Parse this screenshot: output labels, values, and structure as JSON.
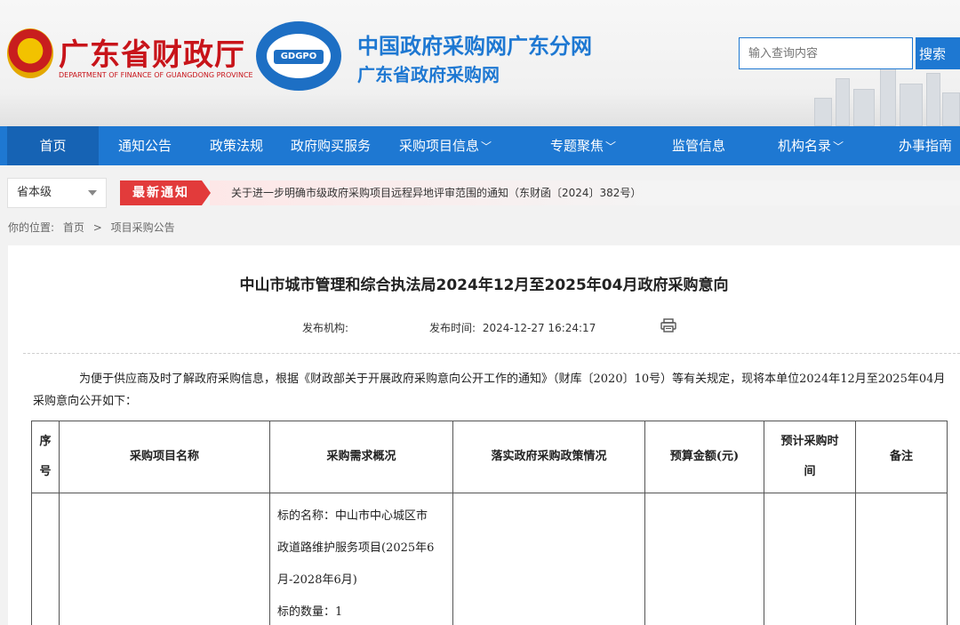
{
  "header": {
    "dept_name_cn": "广东省财政厅",
    "dept_name_en": "DEPARTMENT OF FINANCE OF GUANGDONG PROVINCE",
    "logo_text": "GDGPO",
    "site_title": "中国政府采购网广东分网",
    "site_subtitle": "广东省政府采购网",
    "search": {
      "placeholder": "输入查询内容",
      "button_label": "搜索"
    }
  },
  "nav": {
    "items": [
      {
        "label": "首页"
      },
      {
        "label": "通知公告"
      },
      {
        "label": "政策法规"
      },
      {
        "label": "政府购买服务"
      },
      {
        "label": "采购项目信息"
      },
      {
        "label": "专题聚焦"
      },
      {
        "label": "监管信息"
      },
      {
        "label": "机构名录"
      },
      {
        "label": "办事指南"
      }
    ],
    "active_index": 0
  },
  "notice_bar": {
    "level_select": "省本级",
    "badge": "最新通知",
    "text": "关于进一步明确市级政府采购项目远程异地评审范围的通知（东财函〔2024〕382号）"
  },
  "breadcrumb": {
    "prefix": "你的位置:",
    "items": [
      "首页",
      ">",
      "项目采购公告"
    ]
  },
  "article": {
    "title": "中山市城市管理和综合执法局2024年12月至2025年04月政府采购意向",
    "publisher_label": "发布机构:",
    "publisher_value": "",
    "time_label": "发布时间:",
    "time_value": "2024-12-27 16:24:17",
    "intro": "为便于供应商及时了解政府采购信息，根据《财政部关于开展政府采购意向公开工作的通知》（财库〔2020〕10号）等有关规定，现将本单位2024年12月至2025年04月采购意向公开如下："
  },
  "table": {
    "headers": {
      "no": [
        "序",
        "号"
      ],
      "name": "采购项目名称",
      "requirement": "采购需求概况",
      "policy": "落实政府采购政策情况",
      "budget": "预算金额(元)",
      "time": [
        "预计采购时",
        "间"
      ],
      "remark": "备注"
    },
    "rows": [
      {
        "no": "",
        "name": "",
        "requirement_lines": [
          "标的名称：中山市中心城区市",
          "政道路维护服务项目(2025年6",
          "月-2028年6月)",
          "标的数量：1"
        ],
        "policy": "",
        "budget": "",
        "time": "",
        "remark": ""
      }
    ]
  },
  "colors": {
    "primary_blue": "#1e78d2",
    "nav_active": "#1663b4",
    "brand_red": "#c8141a",
    "badge_red": "#e23b3b"
  }
}
